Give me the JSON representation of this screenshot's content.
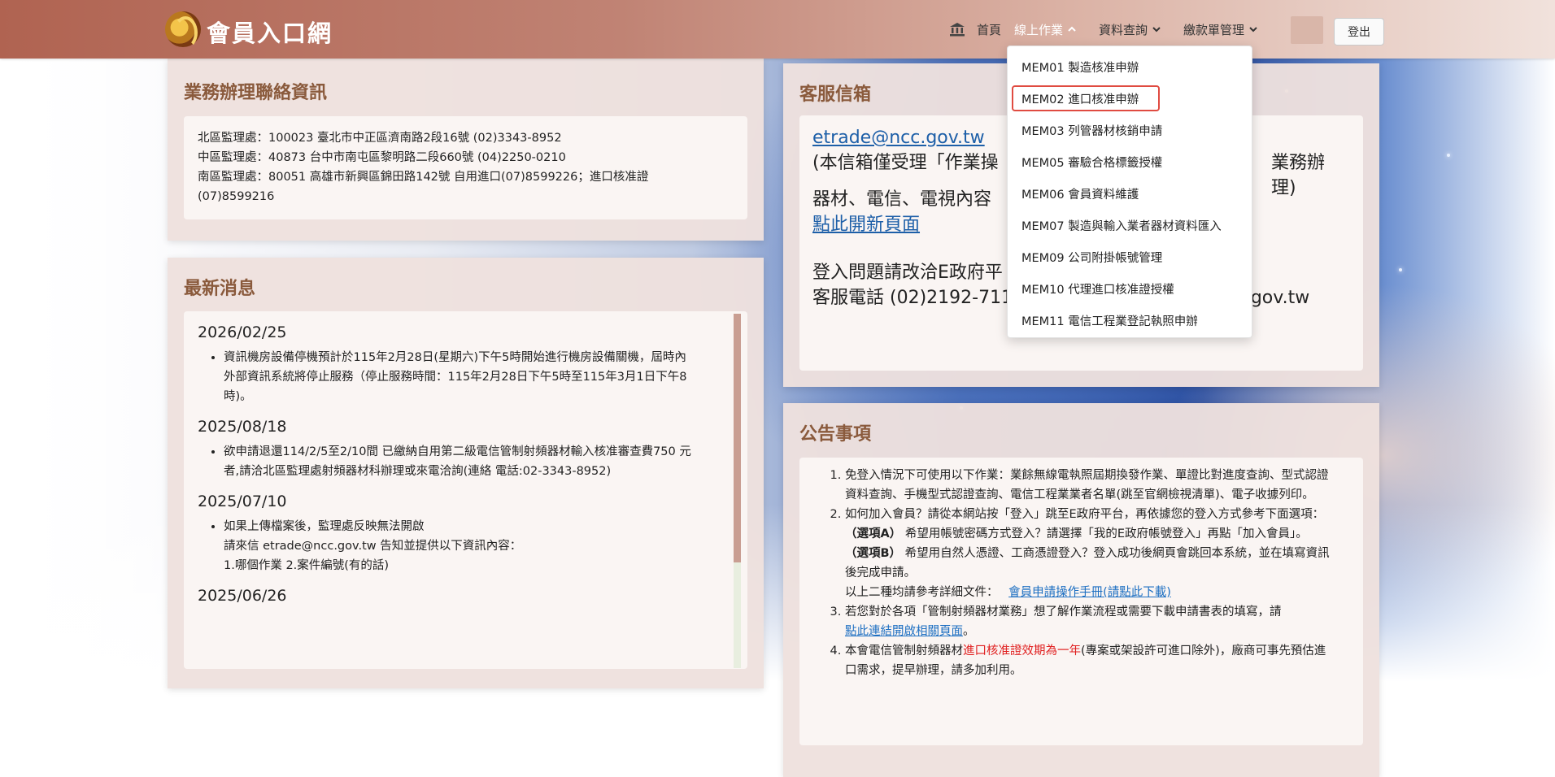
{
  "header": {
    "site_title": "會員入口網",
    "nav": {
      "home": "首頁",
      "online_ops": "線上作業",
      "data_query": "資料查詢",
      "payment_mgmt": "繳款單管理"
    },
    "logout": "登出"
  },
  "dropdown": {
    "items": [
      "MEM01 製造核准申辦",
      "MEM02 進口核准申辦",
      "MEM03 列管器材核銷申請",
      "MEM05 審驗合格標籤授權",
      "MEM06 會員資料維護",
      "MEM07 製造與輸入業者器材資料匯入",
      "MEM09 公司附掛帳號管理",
      "MEM10 代理進口核准證授權",
      "MEM11 電信工程業登記執照申辦"
    ]
  },
  "contact": {
    "title": "業務辦理聯絡資訊",
    "lines": [
      "北區監理處：100023 臺北市中正區濟南路2段16號 (02)3343-8952",
      "中區監理處：40873 台中市南屯區黎明路二段660號 (04)2250-0210",
      "南區監理處：80051 高雄市新興區錦田路142號 自用進口(07)8599226；進口核准證",
      "(07)8599216"
    ]
  },
  "news": {
    "title": "最新消息",
    "entries": [
      {
        "date": "2026/02/25",
        "lines": [
          "資訊機房設備停機預計於115年2月28日(星期六)下午5時開始進行機房設備關機，屆時內",
          "外部資訊系統將停止服務（停止服務時間：115年2月28日下午5時至115年3月1日下午8",
          "時)。"
        ]
      },
      {
        "date": "2025/08/18",
        "lines": [
          "欲申請退還114/2/5至2/10間 已繳納自用第二級電信管制射頻器材輸入核准審查費750 元",
          "者,請洽北區監理處射頻器材科辦理或來電洽詢(連絡 電話:02-3343-8952)"
        ]
      },
      {
        "date": "2025/07/10",
        "lines": [
          "如果上傳檔案後，監理處反映無法開啟",
          "請來信 etrade@ncc.gov.tw 告知並提供以下資訊內容：",
          "1.哪個作業 2.案件編號(有的話)"
        ]
      },
      {
        "date": "2025/06/26",
        "lines": []
      }
    ]
  },
  "service": {
    "title": "客服信箱",
    "email_link": "etrade@ncc.gov.tw",
    "line1": "(本信箱僅受理「作業操",
    "line1_end": "業務辦理)",
    "line2": "器材、電信、電視內容",
    "open_link": "點此開新頁面",
    "line3": "登入問題請改洽E政府平",
    "line4": "客服電話 (02)2192-7111，客服信箱 egov@service.gov.tw"
  },
  "notice": {
    "title": "公告事項",
    "item1": "免登入情況下可使用以下作業：業餘無線電執照屆期換發作業、單證比對進度查詢、型式認證資料查詢、手機型式認證查詢、電信工程業業者名單(跳至官網檢視清單)、電子收據列印。",
    "item2_a": "如何加入會員？請從本網站按「登入」跳至E政府平台，再依據您的登入方式參考下面選項：",
    "item2_optA_label": "（選項A）",
    "item2_optA": " 希望用帳號密碼方式登入？請選擇「我的E政府帳號登入」再點「加入會員」。",
    "item2_optB_label": "（選項B）",
    "item2_optB": " 希望用自然人憑證、工商憑證登入？登入成功後網頁會跳回本系統，並在填寫資訊後完成申請。",
    "item2_doc": "以上二種均請參考詳細文件：",
    "item2_doc_link": "會員申請操作手冊(請點此下載)",
    "item3": "若您對於各項「管制射頻器材業務」想了解作業流程或需要下載申請書表的填寫，請",
    "item3_link": "點此連結開啟相關頁面",
    "item3_end": "。",
    "item4_a": "本會電信管制射頻器材",
    "item4_red": "進口核准證效期為一年",
    "item4_b": "(專案或架設許可進口除外)，廠商可事先預估進口需求，提早辦理，請多加利用。"
  },
  "colors": {
    "header_start": "#b06351",
    "panel_bg": "#eee1de",
    "panel_title": "#8a5a3c",
    "highlight": "#e04b41",
    "link": "#1d5fa8"
  }
}
